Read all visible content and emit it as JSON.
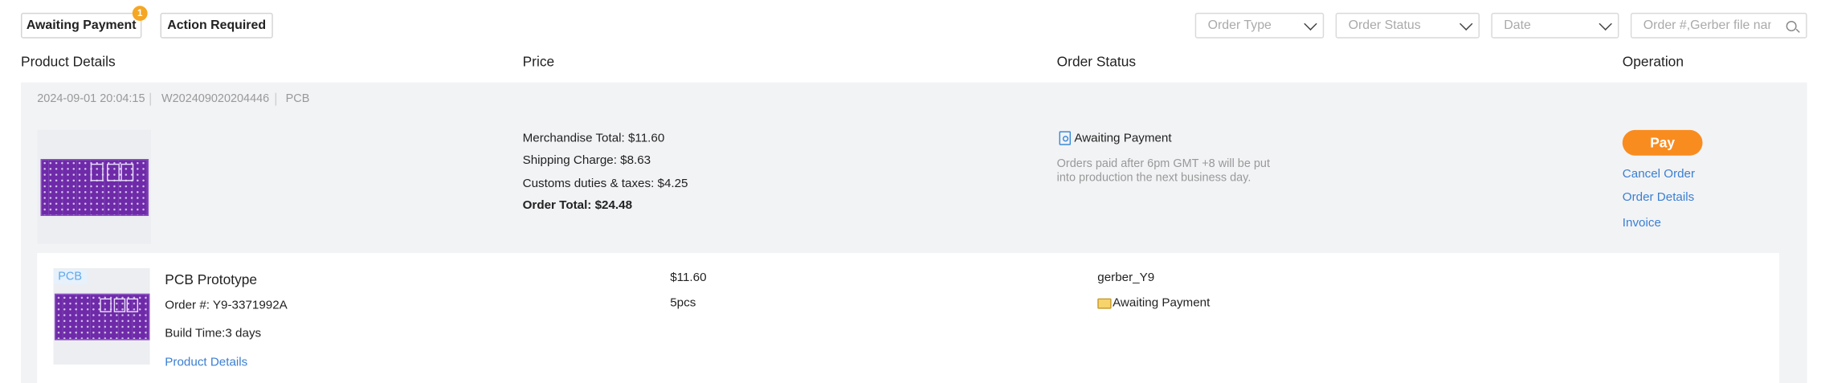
{
  "tabs": [
    {
      "label": "Awaiting Payment",
      "badge": "1"
    },
    {
      "label": "Action Required"
    }
  ],
  "filters": {
    "order_type": "Order Type",
    "order_status": "Order Status",
    "date": "Date",
    "search_placeholder": "Order #,Gerber file name..."
  },
  "columns": {
    "product_details": "Product Details",
    "price": "Price",
    "order_status": "Order Status",
    "operation": "Operation"
  },
  "order": {
    "datetime": "2024-09-01 20:04:15",
    "order_id": "W202409020204446",
    "category": "PCB",
    "price": {
      "merchandise": "Merchandise Total: $11.60",
      "shipping": "Shipping Charge: $8.63",
      "customs": "Customs duties & taxes: $4.25",
      "total": "Order Total: $24.48"
    },
    "status": {
      "label": "Awaiting Payment",
      "note": "Orders paid after 6pm GMT +8 will be put into production the next business day."
    },
    "operations": {
      "pay": "Pay",
      "cancel": "Cancel Order",
      "details": "Order Details",
      "invoice": "Invoice"
    },
    "item": {
      "tag": "PCB",
      "title": "PCB Prototype",
      "order_no": "Order #: Y9-3371992A",
      "build_time": "Build Time:3 days",
      "details_link": "Product Details",
      "price": "$11.60",
      "quantity": "5pcs",
      "file": "gerber_Y9",
      "status": "Awaiting Payment"
    }
  },
  "colors": {
    "accent_orange": "#f98c1f",
    "link_blue": "#3b7fd1",
    "badge": "#f5a623",
    "pcb_purple": "#6e2aa8"
  },
  "icons": [
    "chevron-down-icon",
    "search-icon",
    "order-status-icon",
    "folder-icon"
  ]
}
